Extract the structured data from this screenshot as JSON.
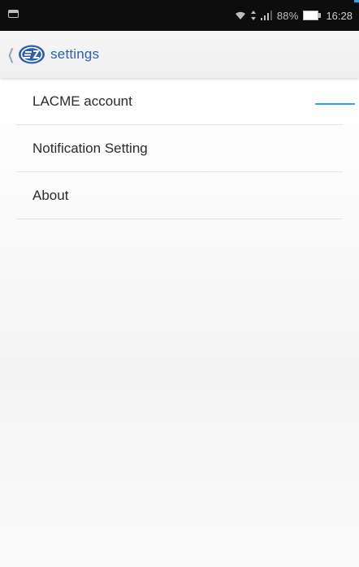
{
  "status_bar": {
    "battery": "88%",
    "time": "16:28"
  },
  "header": {
    "title": "settings"
  },
  "menu": {
    "items": [
      {
        "label": "LACME account"
      },
      {
        "label": "Notification Setting"
      },
      {
        "label": "About"
      }
    ]
  },
  "colors": {
    "accent": "#2aa5e5",
    "title": "#2f5fa8",
    "logo": "#2f5fa8"
  }
}
